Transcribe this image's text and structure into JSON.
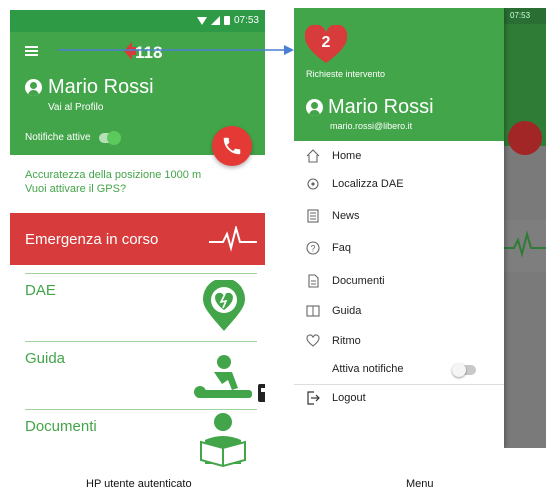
{
  "left_screen": {
    "status_time": "07:53",
    "logo_text": "118",
    "user_name": "Mario Rossi",
    "profile_link": "Vai al Profilo",
    "notifications_label": "Notifiche attive",
    "gps_line1": "Accuratezza della posizione 1000 m",
    "gps_line2": "Vuoi attivare il GPS?",
    "emergency_label": "Emergenza in corso",
    "cards": [
      {
        "label": "DAE",
        "icon": "aed-pin-icon"
      },
      {
        "label": "Guida",
        "icon": "cpr-icon"
      },
      {
        "label": "Documenti",
        "icon": "reader-icon"
      }
    ],
    "caption": "HP utente autenticato"
  },
  "right_screen": {
    "status_time": "07:53",
    "request_count": "2",
    "request_label": "Richieste intervento",
    "user_name": "Mario Rossi",
    "user_email": "mario.rossi@libero.it",
    "menu_items": [
      {
        "label": "Home",
        "icon": "home-icon"
      },
      {
        "label": "Localizza DAE",
        "icon": "locate-icon"
      },
      {
        "label": "News",
        "icon": "news-icon"
      },
      {
        "label": "Faq",
        "icon": "help-icon"
      },
      {
        "label": "Documenti",
        "icon": "document-icon"
      },
      {
        "label": "Guida",
        "icon": "book-icon"
      },
      {
        "label": "Ritmo",
        "icon": "heart-outline-icon"
      },
      {
        "label": "Attiva notifiche",
        "icon": ""
      }
    ],
    "logout_label": "Logout",
    "caption": "Menu"
  },
  "colors": {
    "green": "#43a549",
    "dark_green": "#2e9a45",
    "red": "#e53935",
    "emergency_red": "#d73b3b"
  }
}
